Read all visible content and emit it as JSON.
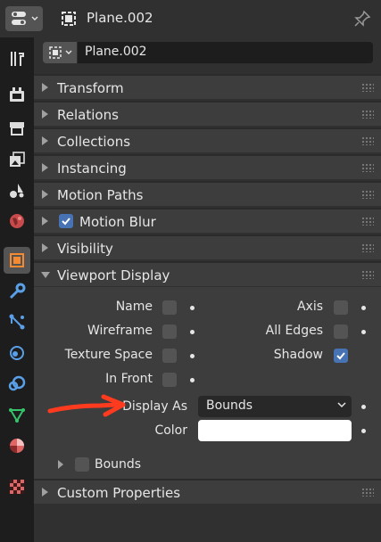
{
  "header": {
    "title": "Plane.002"
  },
  "object": {
    "name": "Plane.002"
  },
  "tabs": [
    {
      "name": "tool-icon"
    },
    {
      "name": "render-icon"
    },
    {
      "name": "output-icon"
    },
    {
      "name": "view-layer-icon"
    },
    {
      "name": "scene-icon"
    },
    {
      "name": "world-icon"
    },
    {
      "name": "object-icon",
      "active": true
    },
    {
      "name": "modifier-icon"
    },
    {
      "name": "particles-icon"
    },
    {
      "name": "physics-icon"
    },
    {
      "name": "constraints-icon"
    },
    {
      "name": "data-icon"
    },
    {
      "name": "material-icon"
    },
    {
      "name": "texture-icon"
    }
  ],
  "panels": {
    "transform": "Transform",
    "relations": "Relations",
    "collections": "Collections",
    "instancing": "Instancing",
    "motion_paths": "Motion Paths",
    "motion_blur": "Motion Blur",
    "visibility": "Visibility",
    "viewport_display": "Viewport Display",
    "custom_properties": "Custom Properties"
  },
  "viewport_display": {
    "name_label": "Name",
    "wireframe_label": "Wireframe",
    "texture_space_label": "Texture Space",
    "in_front_label": "In Front",
    "axis_label": "Axis",
    "all_edges_label": "All Edges",
    "shadow_label": "Shadow",
    "display_as_label": "Display As",
    "display_as_value": "Bounds",
    "color_label": "Color",
    "bounds_label": "Bounds"
  },
  "colors": {
    "accent": "#4772b3",
    "object_tab": "#f58a30",
    "annotation": "#ff3b1f",
    "object_color": "#ffffff"
  }
}
